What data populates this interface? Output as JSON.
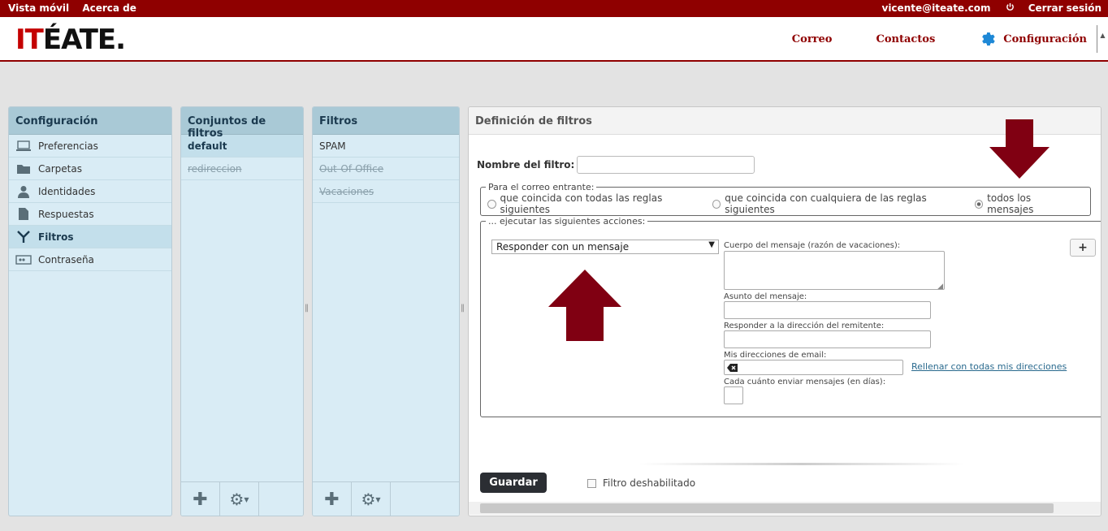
{
  "topbar": {
    "mobile_view": "Vista móvil",
    "about": "Acerca de",
    "user_email": "vicente@iteate.com",
    "logout": "Cerrar sesión"
  },
  "logo": {
    "red_part": "IT",
    "black_part": "ÉATE."
  },
  "nav": {
    "mail": "Correo",
    "contacts": "Contactos",
    "settings": "Configuración"
  },
  "config_panel": {
    "title": "Configuración",
    "items": [
      {
        "label": "Preferencias",
        "icon": "laptop-icon"
      },
      {
        "label": "Carpetas",
        "icon": "folder-icon"
      },
      {
        "label": "Identidades",
        "icon": "person-icon"
      },
      {
        "label": "Respuestas",
        "icon": "document-icon"
      },
      {
        "label": "Filtros",
        "icon": "filter-icon"
      },
      {
        "label": "Contraseña",
        "icon": "password-icon"
      }
    ]
  },
  "filter_sets": {
    "title": "Conjuntos de filtros",
    "items": [
      "default",
      "redireccion"
    ]
  },
  "filters": {
    "title": "Filtros",
    "items": [
      "SPAM",
      "Out-Of-Office",
      "Vacaciones"
    ]
  },
  "definition": {
    "title": "Definición de filtros",
    "name_label": "Nombre del filtro:",
    "name_value": "",
    "incoming_legend": "Para el correo entrante:",
    "option_all_rules": "que coincida con todas las reglas siguientes",
    "option_any_rule": "que coincida con cualquiera de las reglas siguientes",
    "option_all_messages": "todos los mensajes",
    "actions_legend": "... ejecutar las siguientes acciones:",
    "action_selected": "Responder con un mensaje",
    "body_label": "Cuerpo del mensaje (razón de vacaciones):",
    "subject_label": "Asunto del mensaje:",
    "reply_to_label": "Responder a la dirección del remitente:",
    "my_addresses_label": "Mis direcciones de email:",
    "fill_addresses_link": "Rellenar con todas mis direcciones",
    "interval_label": "Cada cuánto enviar mensajes (en días):",
    "add_action": "+",
    "save": "Guardar",
    "filter_disabled": "Filtro deshabilitado"
  },
  "colors": {
    "brand_red": "#8f0000",
    "panel_blue": "#d9ecf5",
    "panel_header": "#a9c9d6",
    "annotation_arrow": "#800012"
  }
}
